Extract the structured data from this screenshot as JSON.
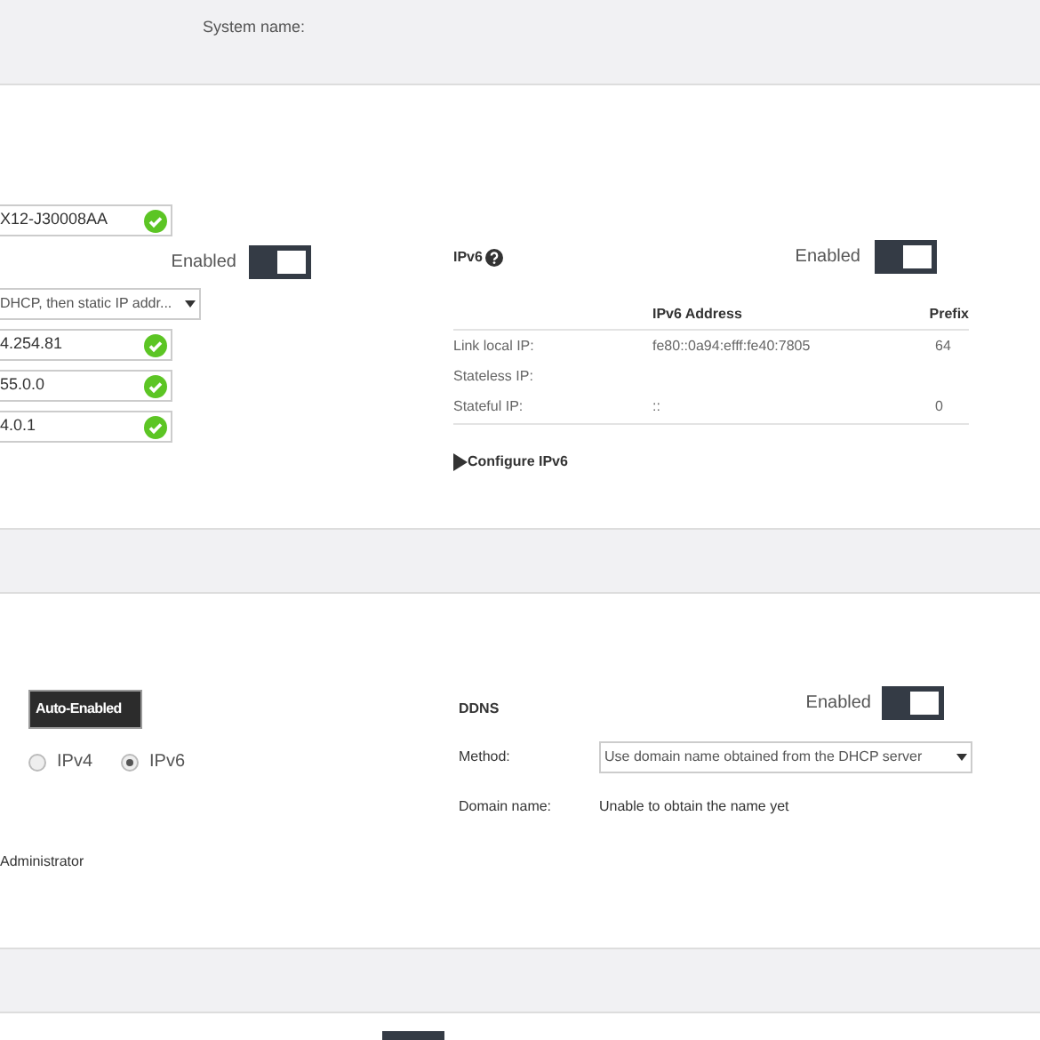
{
  "header": {
    "label": "System name:"
  },
  "network": {
    "host_field": {
      "value": "X12-J30008AA",
      "valid": true
    },
    "ipv4_toggle": {
      "label": "Enabled",
      "on": true
    },
    "mode_select": {
      "value": "DHCP, then static IP addr..."
    },
    "address_fields": [
      {
        "value": "4.254.81",
        "valid": true
      },
      {
        "value": "55.0.0",
        "valid": true
      },
      {
        "value": "4.0.1",
        "valid": true
      }
    ]
  },
  "ipv6": {
    "title": "IPv6",
    "toggle": {
      "label": "Enabled",
      "on": true
    },
    "table": {
      "columns": {
        "address": "IPv6 Address",
        "prefix": "Prefix"
      },
      "rows": [
        {
          "label": "Link local IP:",
          "address": "fe80::0a94:efff:fe40:7805",
          "prefix": "64"
        },
        {
          "label": "Stateless IP:"
        },
        {
          "label": "Stateful IP:",
          "address": "::",
          "prefix": "0"
        }
      ]
    },
    "configure_link": {
      "label": "Configure IPv6",
      "expanded": false
    }
  },
  "services": {
    "badge": "Auto-Enabled",
    "radios": [
      {
        "label": "IPv4",
        "selected": false
      },
      {
        "label": "IPv6",
        "selected": true
      }
    ],
    "user": "Administrator"
  },
  "ddns": {
    "title": "DDNS",
    "toggle": {
      "label": "Enabled",
      "on": true
    },
    "method": {
      "label": "Method:",
      "value": "Use domain name obtained from the DHCP server"
    },
    "domain": {
      "label": "Domain name:",
      "value": "Unable to obtain the name yet"
    }
  }
}
